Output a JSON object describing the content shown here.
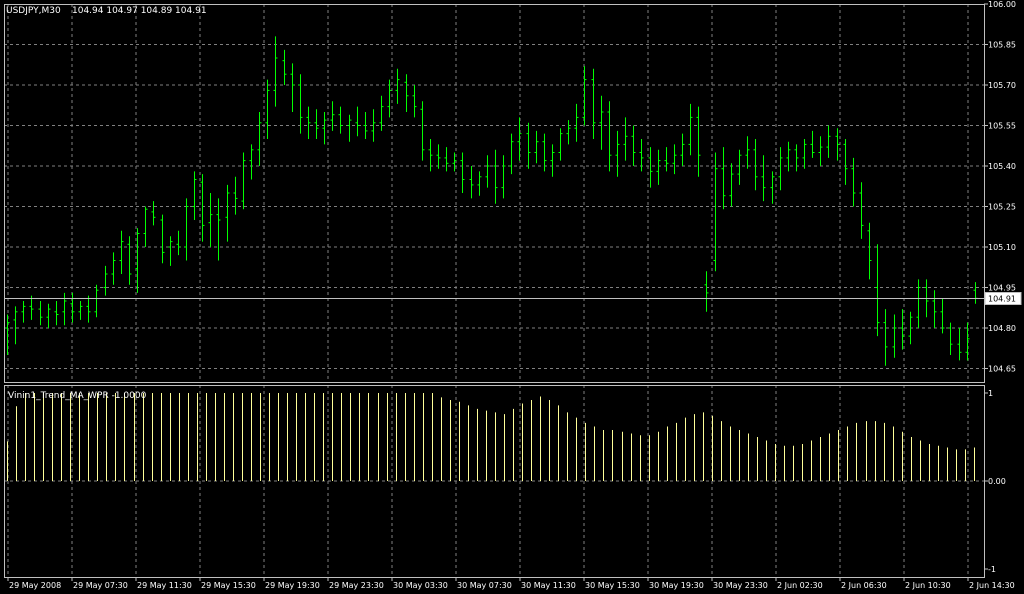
{
  "header": {
    "symbol_timeframe": "USDJPY,M30",
    "ohlc": "104.94 104.97 104.89 104.91"
  },
  "indicator": {
    "label": "Vinin1_Trend_MA_WPR -1.0000",
    "axis_labels": [
      "1",
      "0.00",
      "-1"
    ]
  },
  "colors": {
    "background": "#000000",
    "price_bar": "#00FF00",
    "indicator_bar": "#FFFF99",
    "grid": "#808080",
    "frame": "#C0C0C0",
    "text": "#FFFFFF",
    "current_price_line": "#C0C0C0"
  },
  "chart_data": [
    {
      "type": "ohlc",
      "title": "USDJPY,M30",
      "ylim": [
        104.6,
        106.0
      ],
      "price_axis_labels": [
        "106.00",
        "105.85",
        "105.70",
        "105.55",
        "105.40",
        "105.25",
        "105.10",
        "104.95",
        "104.80",
        "104.65"
      ],
      "current_price": "104.91",
      "time_labels": [
        "29 May 2008",
        "29 May 07:30",
        "29 May 11:30",
        "29 May 15:30",
        "29 May 19:30",
        "29 May 23:30",
        "30 May 03:30",
        "30 May 07:30",
        "30 May 11:30",
        "30 May 15:30",
        "30 May 19:30",
        "30 May 23:30",
        "2 Jun 02:30",
        "2 Jun 06:30",
        "2 Jun 10:30",
        "2 Jun 14:30"
      ],
      "bars": [
        [
          104.8,
          104.85,
          104.7,
          104.82
        ],
        [
          104.83,
          104.88,
          104.74,
          104.86
        ],
        [
          104.86,
          104.9,
          104.82,
          104.88
        ],
        [
          104.88,
          104.92,
          104.83,
          104.87
        ],
        [
          104.87,
          104.9,
          104.81,
          104.84
        ],
        [
          104.84,
          104.89,
          104.8,
          104.87
        ],
        [
          104.86,
          104.9,
          104.81,
          104.85
        ],
        [
          104.86,
          104.93,
          104.81,
          104.9
        ],
        [
          104.89,
          104.93,
          104.82,
          104.86
        ],
        [
          104.86,
          104.9,
          104.83,
          104.88
        ],
        [
          104.88,
          104.92,
          104.82,
          104.86
        ],
        [
          104.86,
          104.96,
          104.84,
          104.94
        ],
        [
          104.95,
          105.03,
          104.92,
          105.0
        ],
        [
          105.0,
          105.08,
          104.96,
          105.05
        ],
        [
          105.05,
          105.16,
          105.0,
          105.12
        ],
        [
          105.11,
          105.14,
          104.96,
          105.0
        ],
        [
          105.02,
          105.17,
          104.93,
          105.15
        ],
        [
          105.15,
          105.25,
          105.1,
          105.24
        ],
        [
          105.23,
          105.27,
          105.18,
          105.21
        ],
        [
          105.2,
          105.22,
          105.04,
          105.08
        ],
        [
          105.1,
          105.14,
          105.03,
          105.12
        ],
        [
          105.11,
          105.16,
          105.07,
          105.1
        ],
        [
          105.1,
          105.28,
          105.05,
          105.25
        ],
        [
          105.25,
          105.38,
          105.2,
          105.35
        ],
        [
          105.34,
          105.37,
          105.12,
          105.18
        ],
        [
          105.19,
          105.3,
          105.1,
          105.22
        ],
        [
          105.22,
          105.28,
          105.05,
          105.2
        ],
        [
          105.21,
          105.33,
          105.12,
          105.3
        ],
        [
          105.3,
          105.36,
          105.22,
          105.28
        ],
        [
          105.27,
          105.45,
          105.24,
          105.42
        ],
        [
          105.42,
          105.48,
          105.35,
          105.46
        ],
        [
          105.46,
          105.6,
          105.4,
          105.56
        ],
        [
          105.56,
          105.72,
          105.5,
          105.68
        ],
        [
          105.68,
          105.88,
          105.62,
          105.8
        ],
        [
          105.79,
          105.83,
          105.7,
          105.74
        ],
        [
          105.74,
          105.78,
          105.6,
          105.7
        ],
        [
          105.7,
          105.74,
          105.52,
          105.58
        ],
        [
          105.58,
          105.62,
          105.5,
          105.56
        ],
        [
          105.56,
          105.61,
          105.5,
          105.54
        ],
        [
          105.54,
          105.6,
          105.48,
          105.57
        ],
        [
          105.57,
          105.64,
          105.53,
          105.59
        ],
        [
          105.59,
          105.62,
          105.52,
          105.55
        ],
        [
          105.55,
          105.59,
          105.49,
          105.57
        ],
        [
          105.56,
          105.62,
          105.51,
          105.55
        ],
        [
          105.55,
          105.6,
          105.5,
          105.53
        ],
        [
          105.53,
          105.61,
          105.49,
          105.56
        ],
        [
          105.56,
          105.66,
          105.53,
          105.62
        ],
        [
          105.62,
          105.72,
          105.58,
          105.68
        ],
        [
          105.68,
          105.76,
          105.63,
          105.72
        ],
        [
          105.71,
          105.74,
          105.6,
          105.66
        ],
        [
          105.66,
          105.7,
          105.58,
          105.62
        ],
        [
          105.61,
          105.64,
          105.42,
          105.46
        ],
        [
          105.46,
          105.5,
          105.38,
          105.44
        ],
        [
          105.44,
          105.48,
          105.39,
          105.43
        ],
        [
          105.43,
          105.47,
          105.38,
          105.41
        ],
        [
          105.41,
          105.45,
          105.38,
          105.42
        ],
        [
          105.42,
          105.45,
          105.3,
          105.35
        ],
        [
          105.35,
          105.4,
          105.28,
          105.33
        ],
        [
          105.33,
          105.38,
          105.29,
          105.36
        ],
        [
          105.36,
          105.44,
          105.32,
          105.4
        ],
        [
          105.4,
          105.46,
          105.26,
          105.32
        ],
        [
          105.32,
          105.44,
          105.28,
          105.4
        ],
        [
          105.4,
          105.52,
          105.37,
          105.49
        ],
        [
          105.49,
          105.58,
          105.42,
          105.52
        ],
        [
          105.52,
          105.56,
          105.39,
          105.45
        ],
        [
          105.45,
          105.53,
          105.41,
          105.49
        ],
        [
          105.49,
          105.52,
          105.38,
          105.42
        ],
        [
          105.42,
          105.48,
          105.36,
          105.45
        ],
        [
          105.45,
          105.54,
          105.42,
          105.52
        ],
        [
          105.52,
          105.57,
          105.48,
          105.54
        ],
        [
          105.54,
          105.63,
          105.49,
          105.58
        ],
        [
          105.58,
          105.77,
          105.55,
          105.72
        ],
        [
          105.72,
          105.76,
          105.5,
          105.56
        ],
        [
          105.56,
          105.66,
          105.46,
          105.6
        ],
        [
          105.6,
          105.64,
          105.38,
          105.44
        ],
        [
          105.44,
          105.53,
          105.36,
          105.48
        ],
        [
          105.48,
          105.58,
          105.42,
          105.51
        ],
        [
          105.51,
          105.55,
          105.4,
          105.45
        ],
        [
          105.45,
          105.5,
          105.38,
          105.43
        ],
        [
          105.43,
          105.47,
          105.32,
          105.38
        ],
        [
          105.38,
          105.46,
          105.33,
          105.42
        ],
        [
          105.42,
          105.47,
          105.38,
          105.41
        ],
        [
          105.41,
          105.48,
          105.37,
          105.44
        ],
        [
          105.44,
          105.52,
          105.4,
          105.48
        ],
        [
          105.48,
          105.63,
          105.44,
          105.58
        ],
        [
          105.58,
          105.62,
          105.36,
          105.44
        ],
        [
          104.96,
          105.01,
          104.86,
          104.93
        ],
        [
          105.05,
          105.45,
          105.01,
          105.39
        ],
        [
          105.39,
          105.47,
          105.24,
          105.29
        ],
        [
          105.29,
          105.41,
          105.25,
          105.37
        ],
        [
          105.37,
          105.46,
          105.33,
          105.44
        ],
        [
          105.44,
          105.51,
          105.39,
          105.46
        ],
        [
          105.46,
          105.5,
          105.31,
          105.36
        ],
        [
          105.36,
          105.44,
          105.27,
          105.32
        ],
        [
          105.32,
          105.38,
          105.26,
          105.36
        ],
        [
          105.36,
          105.47,
          105.31,
          105.43
        ],
        [
          105.43,
          105.49,
          105.38,
          105.46
        ],
        [
          105.46,
          105.48,
          105.38,
          105.43
        ],
        [
          105.43,
          105.5,
          105.39,
          105.48
        ],
        [
          105.48,
          105.53,
          105.43,
          105.45
        ],
        [
          105.45,
          105.51,
          105.4,
          105.47
        ],
        [
          105.47,
          105.55,
          105.43,
          105.51
        ],
        [
          105.51,
          105.54,
          105.42,
          105.48
        ],
        [
          105.48,
          105.5,
          105.33,
          105.39
        ],
        [
          105.39,
          105.43,
          105.25,
          105.3
        ],
        [
          105.3,
          105.34,
          105.13,
          105.18
        ],
        [
          105.16,
          105.19,
          104.98,
          105.05
        ],
        [
          104.95,
          105.11,
          104.77,
          104.82
        ],
        [
          104.82,
          104.87,
          104.66,
          104.73
        ],
        [
          104.73,
          104.85,
          104.69,
          104.8
        ],
        [
          104.8,
          104.87,
          104.72,
          104.77
        ],
        [
          104.77,
          104.86,
          104.74,
          104.84
        ],
        [
          104.84,
          104.98,
          104.8,
          104.95
        ],
        [
          104.95,
          104.98,
          104.84,
          104.9
        ],
        [
          104.9,
          104.94,
          104.8,
          104.86
        ],
        [
          104.86,
          104.91,
          104.78,
          104.8
        ],
        [
          104.8,
          104.82,
          104.7,
          104.74
        ],
        [
          104.74,
          104.8,
          104.68,
          104.71
        ],
        [
          104.71,
          104.82,
          104.68,
          104.76
        ],
        [
          104.94,
          104.97,
          104.89,
          104.91
        ]
      ]
    },
    {
      "type": "histogram",
      "title": "Vinin1_Trend_MA_WPR -1.0000",
      "ylim": [
        -1,
        1
      ],
      "values": [
        0.45,
        0.85,
        1,
        1,
        1,
        1,
        1,
        1,
        1,
        1,
        1,
        1,
        1,
        1,
        1,
        1,
        1,
        1,
        1,
        1,
        1,
        1,
        1,
        1,
        1,
        1,
        1,
        1,
        1,
        1,
        1,
        1,
        1,
        1,
        1,
        1,
        1,
        1,
        1,
        1,
        1,
        1,
        1,
        1,
        1,
        1,
        1,
        1,
        0.95,
        0.92,
        0.9,
        0.86,
        0.82,
        0.8,
        0.78,
        0.76,
        0.82,
        0.88,
        0.92,
        0.96,
        0.92,
        0.86,
        0.78,
        0.72,
        0.66,
        0.62,
        0.58,
        0.58,
        0.56,
        0.54,
        0.52,
        0.52,
        0.56,
        0.62,
        0.66,
        0.72,
        0.76,
        0.78,
        0.74,
        0.68,
        0.62,
        0.58,
        0.54,
        0.5,
        0.46,
        0.42,
        0.4,
        0.4,
        0.42,
        0.46,
        0.5,
        0.54,
        0.58,
        0.62,
        0.66,
        0.68,
        0.68,
        0.66,
        0.62,
        0.56,
        0.5,
        0.46,
        0.42,
        0.4,
        0.38,
        0.36,
        0.36,
        0.38
      ]
    }
  ]
}
